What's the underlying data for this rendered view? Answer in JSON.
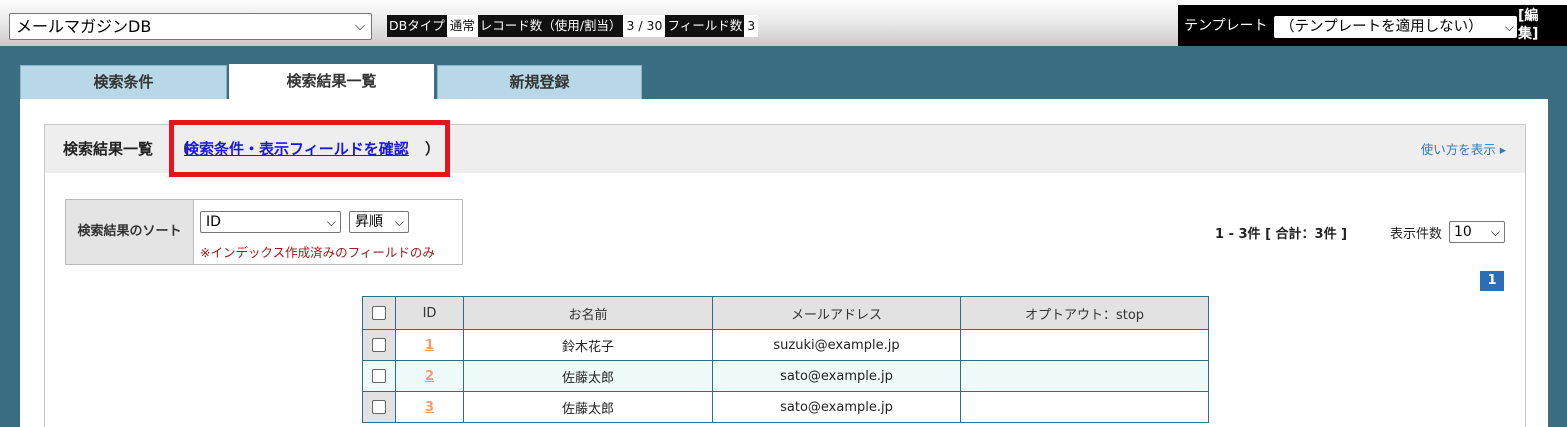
{
  "header": {
    "db_select": "メールマガジンDB",
    "stats": [
      {
        "key": "DBタイプ",
        "value": "通常"
      },
      {
        "key": "レコード数（使用/割当）",
        "value": "3 / 30"
      },
      {
        "key": "フィールド数",
        "value": "3"
      }
    ],
    "template_label": "テンプレート",
    "template_select": "（テンプレートを適用しない）",
    "template_edit": "[編集]"
  },
  "tabs": [
    {
      "label": "検索条件",
      "active": false
    },
    {
      "label": "検索結果一覧",
      "active": true
    },
    {
      "label": "新規登録",
      "active": false
    }
  ],
  "section": {
    "title": "検索結果一覧",
    "open_paren": "（",
    "confirm_link": "検索条件・表示フィールドを確認",
    "close_paren": "）",
    "howto": "使い方を表示 ▸"
  },
  "sort": {
    "label": "検索結果のソート",
    "field_select": "ID",
    "order_select": "昇順",
    "note": "※インデックス作成済みのフィールドのみ"
  },
  "pager": {
    "count_text": "1 - 3件 [ 合計：3件 ]",
    "perpage_label": "表示件数",
    "perpage_value": "10",
    "current_page": "1"
  },
  "table": {
    "headers": [
      "ID",
      "お名前",
      "メールアドレス",
      "オプトアウト：stop"
    ],
    "rows": [
      {
        "id": "1",
        "name": "鈴木花子",
        "email": "suzuki@example.jp",
        "optout": ""
      },
      {
        "id": "2",
        "name": "佐藤太郎",
        "email": "sato@example.jp",
        "optout": ""
      },
      {
        "id": "3",
        "name": "佐藤太郎",
        "email": "sato@example.jp",
        "optout": ""
      }
    ]
  },
  "colors": {
    "background": "#3a6e82",
    "tab_inactive": "#b9d8e7",
    "highlight_box": "#e8141d",
    "link": "#1a1adb",
    "id_link": "#f0a070",
    "page_button": "#2a6eb7"
  }
}
